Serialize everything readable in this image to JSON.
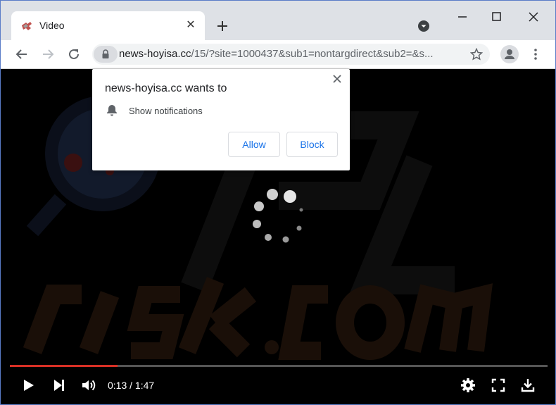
{
  "tab": {
    "title": "Video"
  },
  "toolbar": {
    "url_host": "news-hoyisa.cc",
    "url_path": "/15/?site=1000437&sub1=nontargdirect&sub2=&s..."
  },
  "popup": {
    "title": "news-hoyisa.cc wants to",
    "permission": "Show notifications",
    "allow_label": "Allow",
    "block_label": "Block"
  },
  "video": {
    "time": "0:13 / 1:47",
    "progress_fraction": 0.2
  },
  "colors": {
    "progress": "#d93025",
    "button_text": "#1a73e8",
    "frame": "#5a7cc7"
  }
}
